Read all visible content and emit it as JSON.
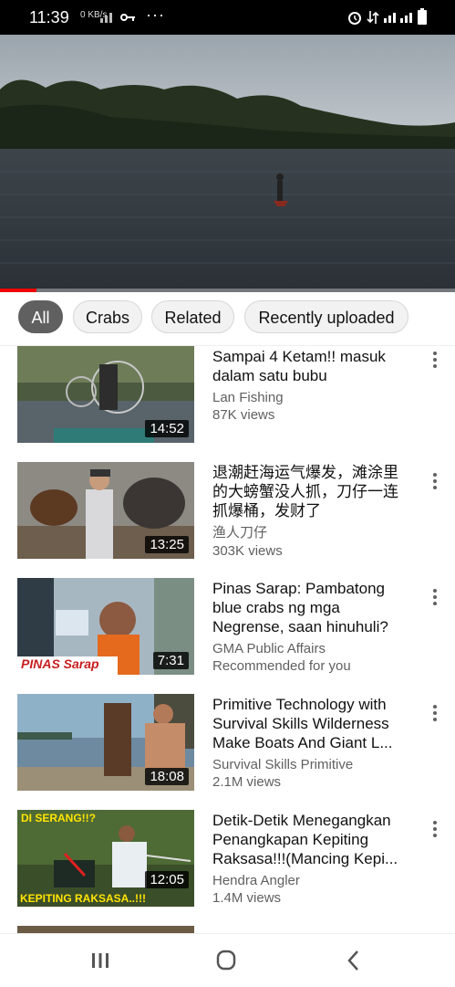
{
  "status_bar": {
    "time": "11:39",
    "net_speed": "0 KB/s"
  },
  "chips": [
    "All",
    "Crabs",
    "Related",
    "Recently uploaded"
  ],
  "videos": [
    {
      "title": "Sampai 4 Ketam!! masuk dalam satu bubu",
      "channel": "Lan Fishing",
      "views": "87K views",
      "duration": "14:52"
    },
    {
      "title": "退潮赶海运气爆发，滩涂里的大螃蟹没人抓，刀仔一连抓爆桶，发财了",
      "channel": "渔人刀仔",
      "views": "303K views",
      "duration": "13:25"
    },
    {
      "title": "Pinas Sarap: Pambatong blue crabs ng mga Negrense, saan hinuhuli?",
      "channel": "GMA Public Affairs",
      "views": "Recommended for you",
      "duration": "7:31"
    },
    {
      "title": "Primitive Technology with Survival Skills Wilderness Make Boats And Giant L...",
      "channel": "Survival Skills Primitive",
      "views": "2.1M views",
      "duration": "18:08"
    },
    {
      "title": "Detik-Detik Menegangkan Penangkapan Kepiting Raksasa!!!(Mancing Kepi...",
      "channel": "Hendra Angler",
      "views": "1.4M views",
      "duration": "12:05"
    }
  ],
  "thumb_overlays": {
    "pinas": "PINAS Sarap",
    "serang": "DI SERANG!!?",
    "kepiting": "KEPITING RAKSASA..!!!"
  }
}
